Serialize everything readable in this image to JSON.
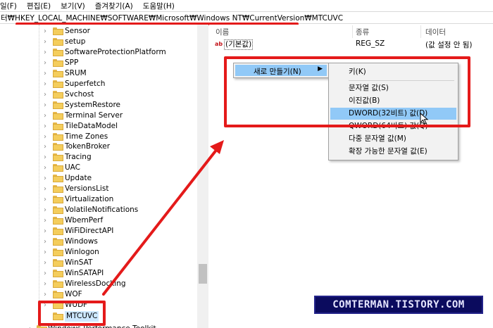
{
  "menubar": {
    "items": [
      "일(F)",
      "편집(E)",
      "보기(V)",
      "즐겨찾기(A)",
      "도움말(H)"
    ]
  },
  "address": {
    "path": "터₩HKEY_LOCAL_MACHINE₩SOFTWARE₩Microsoft₩Windows NT₩CurrentVersion₩MTCUVC"
  },
  "tree": {
    "items": [
      "Sensor",
      "setup",
      "SoftwareProtectionPlatform",
      "SPP",
      "SRUM",
      "Superfetch",
      "Svchost",
      "SystemRestore",
      "Terminal Server",
      "TileDataModel",
      "Time Zones",
      "TokenBroker",
      "Tracing",
      "UAC",
      "Update",
      "VersionsList",
      "Virtualization",
      "VolatileNotifications",
      "WbemPerf",
      "WiFiDirectAPI",
      "Windows",
      "Winlogon",
      "WinSAT",
      "WinSATAPI",
      "WirelessDocking",
      "WOF",
      "WUDF"
    ],
    "selected": "MTCUVC",
    "bottom_item": "Windows Performance Toolkit"
  },
  "list": {
    "columns": [
      "이름",
      "종류",
      "데이터"
    ],
    "rows": [
      {
        "icon": "string-value-icon",
        "icon_text": "ab",
        "name": "(기본값)",
        "type": "REG_SZ",
        "data": "(값 설정 안 됨)"
      }
    ]
  },
  "context_menu": {
    "new_label": "새로 만들기(N)",
    "submenu": {
      "key": "키(K)",
      "string_value": "문자열 값(S)",
      "binary_value": "이진값(B)",
      "dword_value": "DWORD(32비트) 값(D)",
      "qword_value": "QWORD(64비트) 값(Q)",
      "multi_string_value": "다중 문자열 값(M)",
      "expandable_string_value": "확장 가능한 문자열 값(E)"
    }
  },
  "watermark": "COMTERMAN.TISTORY.COM",
  "colors": {
    "annotation_red": "#e41a1a",
    "menu_highlight": "#91c9f7",
    "folder_yellow": "#f4cd5c",
    "watermark_bg": "#0b0b5e"
  }
}
